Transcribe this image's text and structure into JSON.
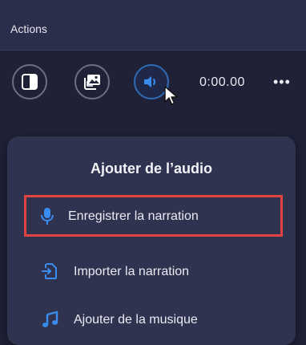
{
  "header": {
    "title": "Actions"
  },
  "toolbar": {
    "visual_icon": "contrast-icon",
    "image_icon": "images-icon",
    "audio_icon": "speaker-icon",
    "timecode": "0:00.00",
    "more_label": "•••"
  },
  "menu": {
    "title": "Ajouter de l’audio",
    "items": [
      {
        "label": "Enregistrer la narration",
        "icon": "microphone-icon"
      },
      {
        "label": "Importer la narration",
        "icon": "import-file-icon"
      },
      {
        "label": "Ajouter de la musique",
        "icon": "music-note-icon"
      }
    ]
  },
  "colors": {
    "accent": "#2f7fe0",
    "highlight_border": "#e2433f",
    "background": "#1f2137",
    "panel": "#303350"
  }
}
